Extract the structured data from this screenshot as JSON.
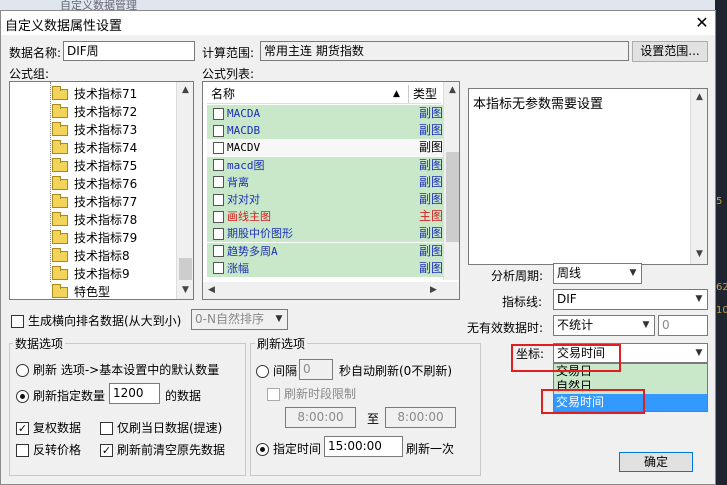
{
  "behind_title": "自定义数据管理",
  "right_strip": [
    "5",
    "62",
    "10"
  ],
  "dialog": {
    "title": "自定义数据属性设置",
    "close": "✕"
  },
  "top": {
    "data_name_label": "数据名称:",
    "data_name_value": "DIF周",
    "range_label": "计算范围:",
    "range_value": "常用主连  期货指数",
    "range_button": "设置范围..."
  },
  "formula_group": {
    "label": "公式组:",
    "items": [
      "技术指标71",
      "技术指标72",
      "技术指标73",
      "技术指标74",
      "技术指标75",
      "技术指标76",
      "技术指标77",
      "技术指标78",
      "技术指标79",
      "技术指标8",
      "技术指标9",
      "特色型"
    ]
  },
  "formula_list": {
    "label": "公式列表:",
    "col_name": "名称",
    "col_type": "类型",
    "rows": [
      {
        "name": "MACDA",
        "type": "副图",
        "color": "#1b2fb8",
        "selected": false
      },
      {
        "name": "MACDB",
        "type": "副图",
        "color": "#1b2fb8",
        "selected": false
      },
      {
        "name": "MACDV",
        "type": "副图",
        "color": "#000000",
        "selected": true
      },
      {
        "name": "macd图",
        "type": "副图",
        "color": "#1b2fb8",
        "selected": false
      },
      {
        "name": "背离",
        "type": "副图",
        "color": "#1b2fb8",
        "selected": false
      },
      {
        "name": "对对对",
        "type": "副图",
        "color": "#1b2fb8",
        "selected": false
      },
      {
        "name": "画线主图",
        "type": "主图叠",
        "color": "#d42020",
        "selected": false
      },
      {
        "name": "期股中价图形",
        "type": "副图",
        "color": "#1b2fb8",
        "selected": false
      },
      {
        "name": "趋势多周A",
        "type": "副图",
        "color": "#1b2fb8",
        "selected": false
      },
      {
        "name": "涨幅",
        "type": "副图",
        "color": "#1b2fb8",
        "selected": false
      }
    ]
  },
  "description": "本指标无参数需要设置",
  "params": {
    "period_label": "分析周期:",
    "period_value": "周线",
    "line_label": "指标线:",
    "line_value": "DIF",
    "invalid_label": "无有效数据时:",
    "invalid_value": "不统计",
    "invalid_number": "0",
    "coord_label": "坐标:",
    "coord_value": "交易时间",
    "coord_options": [
      "交易日",
      "自然日",
      "交易时间"
    ]
  },
  "rank": {
    "label": "生成横向排名数据(从大到小)",
    "select_value": "0-N自然排序"
  },
  "data_options": {
    "title": "数据选项",
    "radio1": "刷新 选项->基本设置中的默认数量",
    "radio2_prefix": "刷新指定数量",
    "radio2_value": "1200",
    "radio2_suffix": "的数据",
    "cb_restore": "复权数据",
    "cb_today": "仅刷当日数据(提速)",
    "cb_reverse": "反转价格",
    "cb_clear": "刷新前清空原先数据"
  },
  "refresh_options": {
    "title": "刷新选项",
    "interval_label": "间隔",
    "interval_value": "0",
    "interval_suffix": "秒自动刷新(0不刷新)",
    "limit_label": "刷新时段限制",
    "time_from": "8:00:00",
    "to_label": "至",
    "time_to": "8:00:00",
    "specified_label": "指定时间",
    "specified_value": "15:00:00",
    "specified_suffix": "刷新一次"
  },
  "ok_button": "确定",
  "colors": {
    "row_green": "#c9e8c9",
    "selected_blue": "#3399ff",
    "accent_red": "#e02020"
  }
}
